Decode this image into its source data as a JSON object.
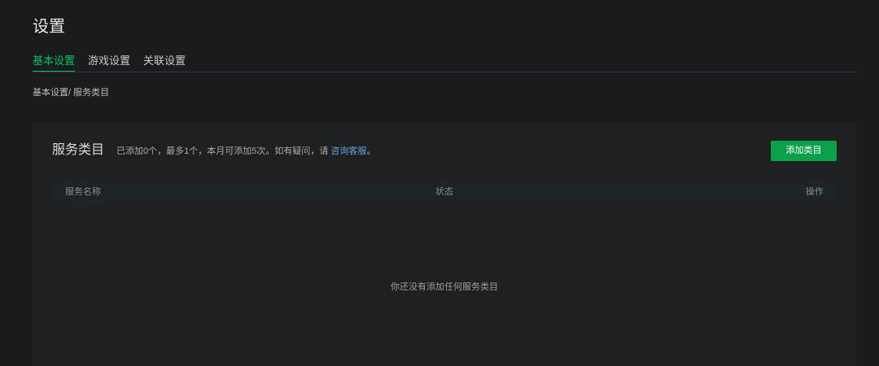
{
  "theme": {
    "bg": "#1a1b1d",
    "card": "#1f2022",
    "accent": "#07c160",
    "button": "#0aa14a",
    "link": "#6f9fd8",
    "header_bg": "#1d2427"
  },
  "page": {
    "title": "设置"
  },
  "tabs": [
    {
      "label": "基本设置",
      "active": true
    },
    {
      "label": "游戏设置",
      "active": false
    },
    {
      "label": "关联设置",
      "active": false
    }
  ],
  "breadcrumb": "基本设置/ 服务类目",
  "card": {
    "title": "服务类目",
    "info": {
      "prefix": "已添加0个，最多1个，本月可添加5次。如有疑问，请 ",
      "link": "咨询客服",
      "suffix": "。"
    },
    "button_label": "添加类目"
  },
  "table": {
    "columns": [
      "服务名称",
      "状态",
      "操作"
    ],
    "empty_text": "你还没有添加任何服务类目"
  }
}
